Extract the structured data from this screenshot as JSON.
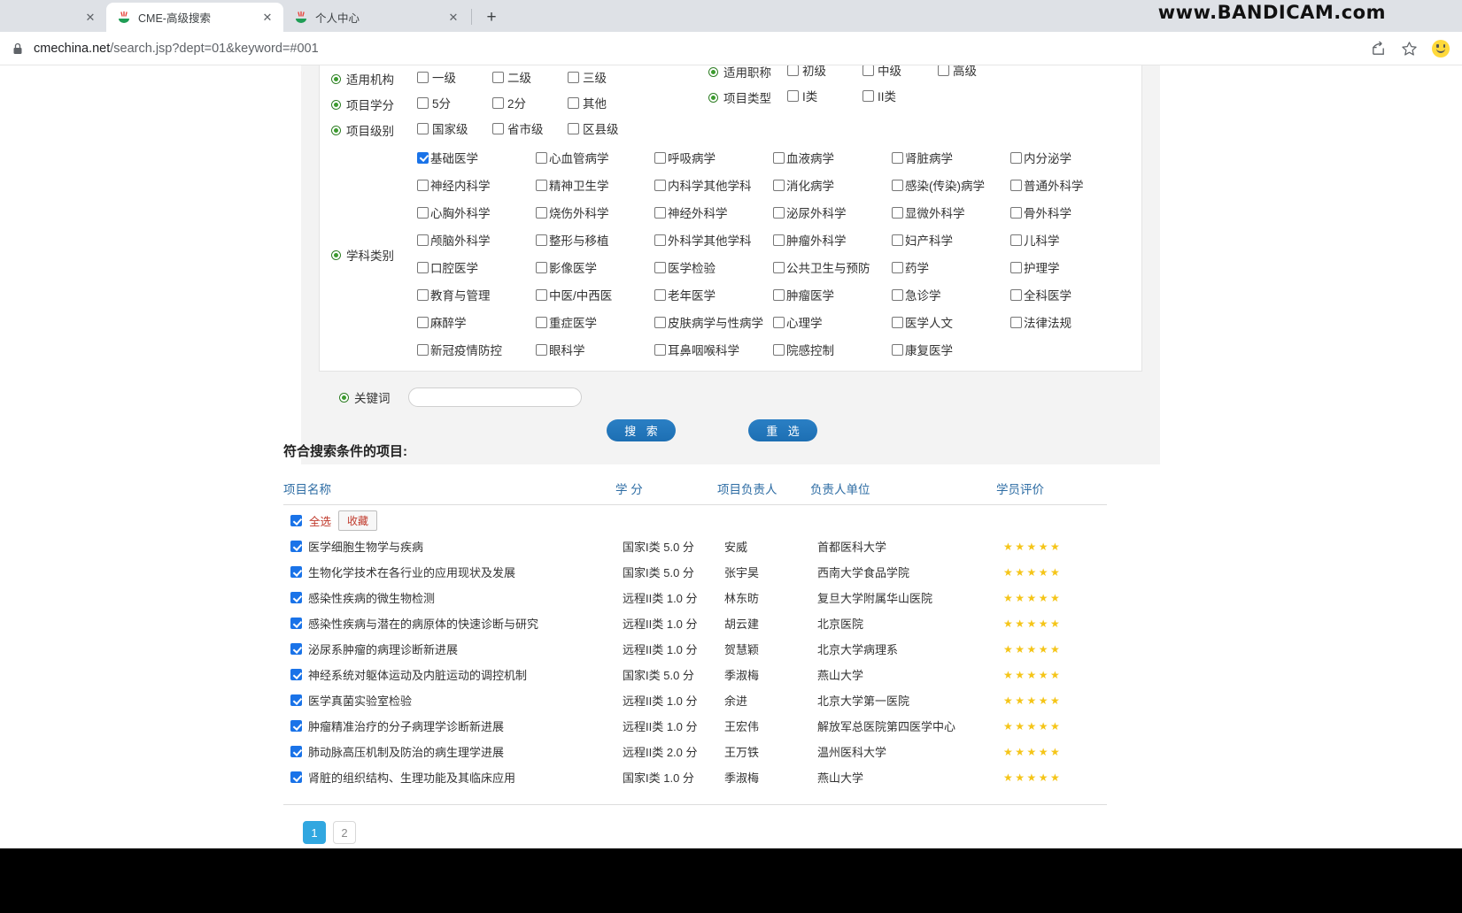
{
  "browser": {
    "tabs": [
      {
        "title": "",
        "favicon": "none",
        "state": "partial"
      },
      {
        "title": "CME-高级搜索",
        "favicon": "cme-icon",
        "state": "active"
      },
      {
        "title": "个人中心",
        "favicon": "cme-icon",
        "state": "inactive"
      }
    ],
    "new_tab_label": "+",
    "close_label": "✕",
    "url_host": "cmechina.net",
    "url_path": "/search.jsp?dept=01&keyword=#001",
    "watermark": "www.BANDICAM.com",
    "icons": [
      "lock-icon",
      "share-icon",
      "bookmark-star-icon",
      "profile-smiley-icon"
    ]
  },
  "filters": {
    "groups": [
      {
        "label": "适用机构",
        "options": [
          {
            "label": "一级",
            "checked": false
          },
          {
            "label": "二级",
            "checked": false
          },
          {
            "label": "三级",
            "checked": false
          }
        ]
      },
      {
        "label": "项目学分",
        "options": [
          {
            "label": "5分",
            "checked": false
          },
          {
            "label": "2分",
            "checked": false
          },
          {
            "label": "其他",
            "checked": false
          }
        ]
      },
      {
        "label": "项目级别",
        "options": [
          {
            "label": "国家级",
            "checked": false
          },
          {
            "label": "省市级",
            "checked": false
          },
          {
            "label": "区县级",
            "checked": false
          }
        ]
      }
    ],
    "right_groups": [
      {
        "label": "适用职称",
        "options": [
          {
            "label": "初级",
            "checked": false
          },
          {
            "label": "中级",
            "checked": false
          },
          {
            "label": "高级",
            "checked": false
          }
        ]
      },
      {
        "label": "项目类型",
        "options": [
          {
            "label": "I类",
            "checked": false
          },
          {
            "label": "II类",
            "checked": false
          }
        ]
      }
    ],
    "subject": {
      "label": "学科类别",
      "options": [
        {
          "label": "基础医学",
          "checked": true
        },
        {
          "label": "心血管病学",
          "checked": false
        },
        {
          "label": "呼吸病学",
          "checked": false
        },
        {
          "label": "血液病学",
          "checked": false
        },
        {
          "label": "肾脏病学",
          "checked": false
        },
        {
          "label": "内分泌学",
          "checked": false
        },
        {
          "label": "神经内科学",
          "checked": false
        },
        {
          "label": "精神卫生学",
          "checked": false
        },
        {
          "label": "内科学其他学科",
          "checked": false
        },
        {
          "label": "消化病学",
          "checked": false
        },
        {
          "label": "感染(传染)病学",
          "checked": false
        },
        {
          "label": "普通外科学",
          "checked": false
        },
        {
          "label": "心胸外科学",
          "checked": false
        },
        {
          "label": "烧伤外科学",
          "checked": false
        },
        {
          "label": "神经外科学",
          "checked": false
        },
        {
          "label": "泌尿外科学",
          "checked": false
        },
        {
          "label": "显微外科学",
          "checked": false
        },
        {
          "label": "骨外科学",
          "checked": false
        },
        {
          "label": "颅脑外科学",
          "checked": false
        },
        {
          "label": "整形与移植",
          "checked": false
        },
        {
          "label": "外科学其他学科",
          "checked": false
        },
        {
          "label": "肿瘤外科学",
          "checked": false
        },
        {
          "label": "妇产科学",
          "checked": false
        },
        {
          "label": "儿科学",
          "checked": false
        },
        {
          "label": "口腔医学",
          "checked": false
        },
        {
          "label": "影像医学",
          "checked": false
        },
        {
          "label": "医学检验",
          "checked": false
        },
        {
          "label": "公共卫生与预防",
          "checked": false
        },
        {
          "label": "药学",
          "checked": false
        },
        {
          "label": "护理学",
          "checked": false
        },
        {
          "label": "教育与管理",
          "checked": false
        },
        {
          "label": "中医/中西医",
          "checked": false
        },
        {
          "label": "老年医学",
          "checked": false
        },
        {
          "label": "肿瘤医学",
          "checked": false
        },
        {
          "label": "急诊学",
          "checked": false
        },
        {
          "label": "全科医学",
          "checked": false
        },
        {
          "label": "麻醉学",
          "checked": false
        },
        {
          "label": "重症医学",
          "checked": false
        },
        {
          "label": "皮肤病学与性病学",
          "checked": false
        },
        {
          "label": "心理学",
          "checked": false
        },
        {
          "label": "医学人文",
          "checked": false
        },
        {
          "label": "法律法规",
          "checked": false
        },
        {
          "label": "新冠疫情防控",
          "checked": false
        },
        {
          "label": "眼科学",
          "checked": false
        },
        {
          "label": "耳鼻咽喉科学",
          "checked": false
        },
        {
          "label": "院感控制",
          "checked": false
        },
        {
          "label": "康复医学",
          "checked": false
        },
        {
          "label": "",
          "checked": false
        }
      ]
    },
    "keyword": {
      "label": "关键词",
      "value": "",
      "placeholder": ""
    },
    "search_button": "搜 索",
    "reset_button": "重 选"
  },
  "results": {
    "title": "符合搜索条件的项目:",
    "columns": [
      "项目名称",
      "学  分",
      "项目负责人",
      "负责人单位",
      "学员评价"
    ],
    "select_all_label": "全选",
    "select_all_checked": true,
    "favorite_button": "收藏",
    "rows": [
      {
        "name": "医学细胞生物学与疾病",
        "credit": "国家I类 5.0 分",
        "owner": "安威",
        "unit": "首都医科大学",
        "stars": 5,
        "checked": true
      },
      {
        "name": "生物化学技术在各行业的应用现状及发展",
        "credit": "国家I类 5.0 分",
        "owner": "张宇昊",
        "unit": "西南大学食品学院",
        "stars": 5,
        "checked": true
      },
      {
        "name": "感染性疾病的微生物检测",
        "credit": "远程II类 1.0 分",
        "owner": "林东昉",
        "unit": "复旦大学附属华山医院",
        "stars": 5,
        "checked": true
      },
      {
        "name": "感染性疾病与潜在的病原体的快速诊断与研究",
        "credit": "远程II类 1.0 分",
        "owner": "胡云建",
        "unit": "北京医院",
        "stars": 5,
        "checked": true
      },
      {
        "name": "泌尿系肿瘤的病理诊断新进展",
        "credit": "远程II类 1.0 分",
        "owner": "贺慧颖",
        "unit": "北京大学病理系",
        "stars": 5,
        "checked": true
      },
      {
        "name": "神经系统对躯体运动及内脏运动的调控机制",
        "credit": "国家I类 5.0 分",
        "owner": "季淑梅",
        "unit": "燕山大学",
        "stars": 5,
        "checked": true
      },
      {
        "name": "医学真菌实验室检验",
        "credit": "远程II类 1.0 分",
        "owner": "余进",
        "unit": "北京大学第一医院",
        "stars": 5,
        "checked": true
      },
      {
        "name": "肿瘤精准治疗的分子病理学诊断新进展",
        "credit": "远程II类 1.0 分",
        "owner": "王宏伟",
        "unit": "解放军总医院第四医学中心",
        "stars": 5,
        "checked": true
      },
      {
        "name": "肺动脉高压机制及防治的病生理学进展",
        "credit": "远程II类 2.0 分",
        "owner": "王万铁",
        "unit": "温州医科大学",
        "stars": 5,
        "checked": true
      },
      {
        "name": "肾脏的组织结构、生理功能及其临床应用",
        "credit": "国家I类 1.0 分",
        "owner": "季淑梅",
        "unit": "燕山大学",
        "stars": 5,
        "checked": true
      }
    ],
    "pagination": [
      {
        "label": "1",
        "active": true
      },
      {
        "label": "2",
        "active": false
      }
    ]
  },
  "colors": {
    "accent_blue": "#1a73e8",
    "link_blue": "#2e6da4",
    "bullet_green": "#3c9b2f",
    "star_yellow": "#f5c518",
    "button_blue": "#1d6fb3",
    "pager_active": "#31a7e0",
    "favorite_red": "#c0392b"
  }
}
